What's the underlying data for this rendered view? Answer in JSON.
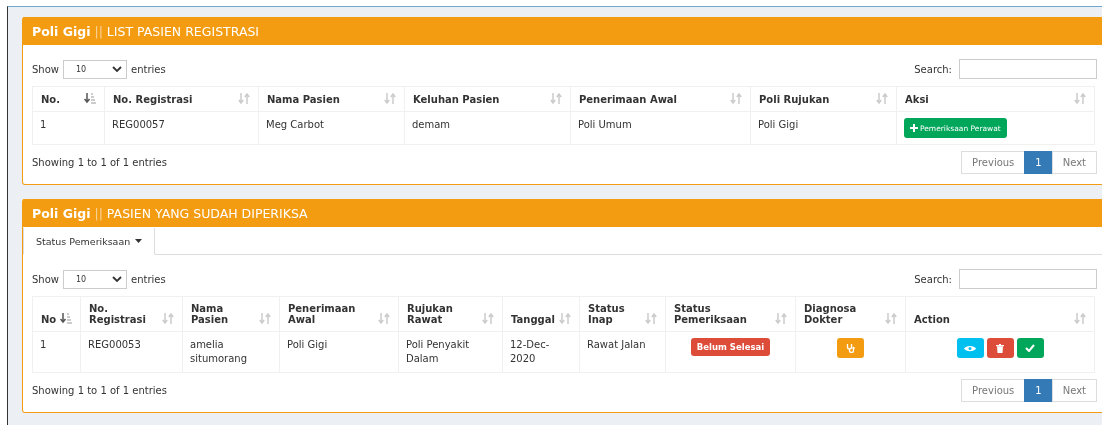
{
  "panels": [
    {
      "title_bold": "Poli Gigi",
      "title_rest": "LIST PASIEN REGISTRASI",
      "separator": "||",
      "length_label_before": "Show",
      "length_value": "10",
      "length_label_after": "entries",
      "search_label": "Search:",
      "columns": [
        {
          "label": "No.",
          "sorted": true
        },
        {
          "label": "No. Registrasi",
          "sorted": false
        },
        {
          "label": "Nama Pasien",
          "sorted": false
        },
        {
          "label": "Keluhan Pasien",
          "sorted": false
        },
        {
          "label": "Penerimaan Awal",
          "sorted": false
        },
        {
          "label": "Poli Rujukan",
          "sorted": false
        },
        {
          "label": "Aksi",
          "sorted": false
        }
      ],
      "rows": [
        [
          {
            "kind": "text",
            "text": "1"
          },
          {
            "kind": "text",
            "text": "REG00057"
          },
          {
            "kind": "text",
            "text": "Meg Carbot"
          },
          {
            "kind": "text",
            "text": "demam"
          },
          {
            "kind": "text",
            "text": "Poli Umum"
          },
          {
            "kind": "text",
            "text": "Poli Gigi"
          },
          {
            "kind": "add_button",
            "text": "Pemeriksaan Perawat"
          }
        ]
      ],
      "info": "Showing 1 to 1 of 1 entries",
      "pages": [
        {
          "label": "Previous",
          "selected": false
        },
        {
          "label": "1",
          "selected": true
        },
        {
          "label": "Next",
          "selected": false
        }
      ]
    },
    {
      "title_bold": "Poli Gigi",
      "title_rest": "PASIEN YANG SUDAH DIPERIKSA",
      "separator": "||",
      "tab": {
        "label": "Status Pemeriksaan"
      },
      "length_label_before": "Show",
      "length_value": "10",
      "length_label_after": "entries",
      "search_label": "Search:",
      "columns": [
        {
          "label": "No",
          "sorted": true
        },
        {
          "label": "No. Registrasi",
          "sorted": false
        },
        {
          "label": "Nama Pasien",
          "sorted": false
        },
        {
          "label": "Penerimaan Awal",
          "sorted": false
        },
        {
          "label": "Rujukan Rawat",
          "sorted": false
        },
        {
          "label": "Tanggal",
          "sorted": false
        },
        {
          "label": "Status Inap",
          "sorted": false
        },
        {
          "label": "Status Pemeriksaan",
          "sorted": false
        },
        {
          "label": "Diagnosa Dokter",
          "sorted": false
        },
        {
          "label": "Action",
          "sorted": false
        }
      ],
      "rows": [
        [
          {
            "kind": "text",
            "text": "1"
          },
          {
            "kind": "text",
            "text": "REG00053"
          },
          {
            "kind": "text",
            "text": "amelia situmorang"
          },
          {
            "kind": "text",
            "text": "Poli Gigi"
          },
          {
            "kind": "text",
            "text": "Poli Penyakit Dalam"
          },
          {
            "kind": "text",
            "text": "12-Dec-2020"
          },
          {
            "kind": "text",
            "text": "Rawat Jalan"
          },
          {
            "kind": "badge",
            "text": "Belum Selesai",
            "color": "#dd4b39"
          },
          {
            "kind": "diagnose_button"
          },
          {
            "kind": "actions"
          }
        ]
      ],
      "info": "Showing 1 to 1 of 1 entries",
      "pages": [
        {
          "label": "Previous",
          "selected": false
        },
        {
          "label": "1",
          "selected": true
        },
        {
          "label": "Next",
          "selected": false
        }
      ]
    }
  ]
}
